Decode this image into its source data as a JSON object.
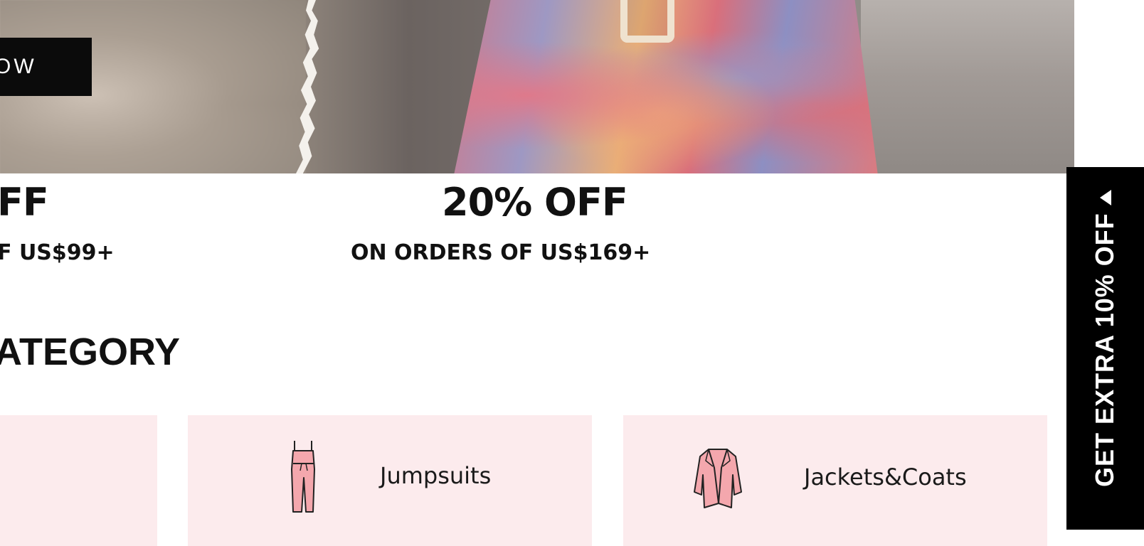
{
  "hero": {
    "shop_button_label": "OW"
  },
  "promos": [
    {
      "headline": "FF",
      "subline": "F US$99+"
    },
    {
      "headline": "20% OFF",
      "subline": "ON ORDERS OF US$169+"
    }
  ],
  "category_section": {
    "title": "ATEGORY"
  },
  "categories": [
    {
      "label": "",
      "icon": "blank"
    },
    {
      "label": "Jumpsuits",
      "icon": "jumpsuit-icon"
    },
    {
      "label": "Jackets&Coats",
      "icon": "jacket-icon"
    }
  ],
  "side_tab": {
    "label": "GET EXTRA 10% OFF",
    "icon": "triangle-left-icon"
  },
  "colors": {
    "card_bg": "#fcebed",
    "icon_fill": "#f4a7ad",
    "tab_bg": "#000000"
  }
}
